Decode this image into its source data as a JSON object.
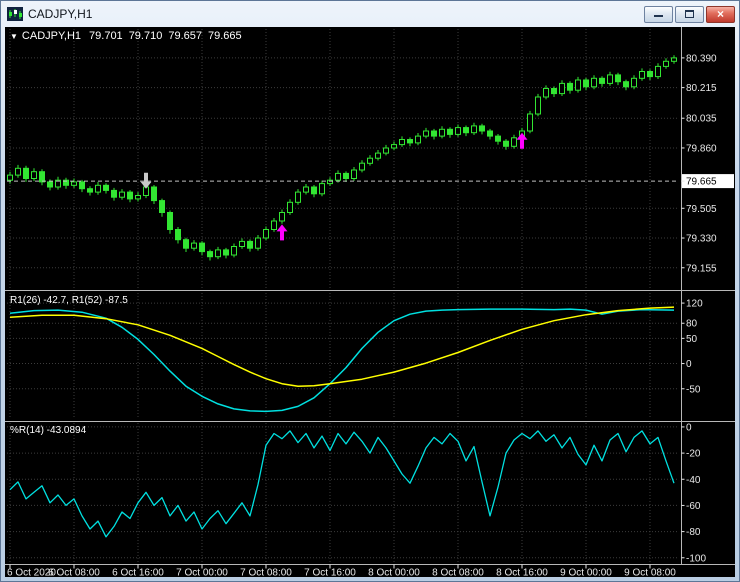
{
  "window": {
    "title": "CADJPY,H1",
    "close_glyph": "×"
  },
  "info_bar": {
    "dropdown_icon": "▼",
    "symbol": "CADJPY,H1",
    "open": "79.701",
    "high": "79.710",
    "low": "79.657",
    "close": "79.665"
  },
  "colors": {
    "background": "#000000",
    "grid": "#3c3c3c",
    "axis_text": "#e8e8e8",
    "separator": "#b8b8b8",
    "bid_line": "#c0c0c0",
    "bid_box_bg": "#ffffff",
    "bid_box_text": "#000000"
  },
  "time_axis": {
    "ticks": [
      {
        "index": 0,
        "label": "6 Oct 2020"
      },
      {
        "index": 8,
        "label": "6 Oct 08:00"
      },
      {
        "index": 16,
        "label": "6 Oct 16:00"
      },
      {
        "index": 24,
        "label": "7 Oct 00:00"
      },
      {
        "index": 32,
        "label": "7 Oct 08:00"
      },
      {
        "index": 40,
        "label": "7 Oct 16:00"
      },
      {
        "index": 48,
        "label": "8 Oct 00:00"
      },
      {
        "index": 56,
        "label": "8 Oct 08:00"
      },
      {
        "index": 64,
        "label": "8 Oct 16:00"
      },
      {
        "index": 72,
        "label": "9 Oct 00:00"
      },
      {
        "index": 80,
        "label": "9 Oct 08:00"
      }
    ]
  },
  "chart_data": [
    {
      "type": "candlestick",
      "title": "CADJPY,H1",
      "timeframe": "H1",
      "ylim": [
        79.03,
        80.56
      ],
      "price_ticks": [
        "80.390",
        "80.215",
        "80.035",
        "79.860",
        "79.505",
        "79.330",
        "79.155"
      ],
      "bid": {
        "price": 79.665,
        "label": "79.665"
      },
      "colors": {
        "outline": "#32e632",
        "wick": "#32e632",
        "bull": "#000000",
        "bear": "#32e632"
      },
      "arrows": [
        {
          "index": 17,
          "price": 79.62,
          "direction": "down",
          "color": "#c8c8c8"
        },
        {
          "index": 34,
          "price": 79.41,
          "direction": "up",
          "color": "#ff00ff"
        },
        {
          "index": 64,
          "price": 79.95,
          "direction": "up",
          "color": "#ff00ff"
        }
      ],
      "candles": [
        [
          79.67,
          79.72,
          79.65,
          79.7
        ],
        [
          79.7,
          79.76,
          79.685,
          79.74
        ],
        [
          79.74,
          79.755,
          79.66,
          79.68
        ],
        [
          79.68,
          79.74,
          79.665,
          79.72
        ],
        [
          79.72,
          79.735,
          79.64,
          79.66
        ],
        [
          79.66,
          79.675,
          79.61,
          79.63
        ],
        [
          79.63,
          79.69,
          79.615,
          79.67
        ],
        [
          79.67,
          79.685,
          79.62,
          79.64
        ],
        [
          79.64,
          79.68,
          79.625,
          79.66
        ],
        [
          79.66,
          79.672,
          79.6,
          79.62
        ],
        [
          79.62,
          79.635,
          79.58,
          79.6
        ],
        [
          79.6,
          79.66,
          79.585,
          79.64
        ],
        [
          79.64,
          79.652,
          79.592,
          79.61
        ],
        [
          79.61,
          79.625,
          79.55,
          79.57
        ],
        [
          79.57,
          79.618,
          79.555,
          79.6
        ],
        [
          79.6,
          79.612,
          79.54,
          79.56
        ],
        [
          79.56,
          79.6,
          79.545,
          79.58
        ],
        [
          79.58,
          79.652,
          79.565,
          79.63
        ],
        [
          79.63,
          79.642,
          79.53,
          79.55
        ],
        [
          79.55,
          79.562,
          79.455,
          79.48
        ],
        [
          79.48,
          79.492,
          79.355,
          79.38
        ],
        [
          79.38,
          79.395,
          79.298,
          79.32
        ],
        [
          79.32,
          79.332,
          79.248,
          79.27
        ],
        [
          79.27,
          79.318,
          79.256,
          79.3
        ],
        [
          79.3,
          79.312,
          79.228,
          79.25
        ],
        [
          79.25,
          79.262,
          79.198,
          79.22
        ],
        [
          79.22,
          79.278,
          79.206,
          79.26
        ],
        [
          79.26,
          79.272,
          79.21,
          79.23
        ],
        [
          79.23,
          79.298,
          79.216,
          79.28
        ],
        [
          79.28,
          79.328,
          79.266,
          79.31
        ],
        [
          79.31,
          79.322,
          79.25,
          79.27
        ],
        [
          79.27,
          79.348,
          79.256,
          79.33
        ],
        [
          79.33,
          79.398,
          79.316,
          79.38
        ],
        [
          79.38,
          79.448,
          79.366,
          79.43
        ],
        [
          79.43,
          79.498,
          79.414,
          79.48
        ],
        [
          79.48,
          79.558,
          79.466,
          79.54
        ],
        [
          79.54,
          79.618,
          79.526,
          79.6
        ],
        [
          79.6,
          79.648,
          79.586,
          79.63
        ],
        [
          79.63,
          79.642,
          79.57,
          79.59
        ],
        [
          79.59,
          79.668,
          79.576,
          79.65
        ],
        [
          79.65,
          79.688,
          79.636,
          79.67
        ],
        [
          79.67,
          79.728,
          79.656,
          79.71
        ],
        [
          79.71,
          79.722,
          79.66,
          79.68
        ],
        [
          79.68,
          79.748,
          79.666,
          79.73
        ],
        [
          79.73,
          79.788,
          79.716,
          79.77
        ],
        [
          79.77,
          79.818,
          79.756,
          79.8
        ],
        [
          79.8,
          79.848,
          79.786,
          79.83
        ],
        [
          79.83,
          79.878,
          79.816,
          79.86
        ],
        [
          79.86,
          79.898,
          79.846,
          79.88
        ],
        [
          79.88,
          79.928,
          79.866,
          79.91
        ],
        [
          79.91,
          79.922,
          79.87,
          79.89
        ],
        [
          79.89,
          79.948,
          79.876,
          79.93
        ],
        [
          79.93,
          79.978,
          79.916,
          79.96
        ],
        [
          79.96,
          79.972,
          79.91,
          79.93
        ],
        [
          79.93,
          79.988,
          79.916,
          79.97
        ],
        [
          79.97,
          79.982,
          79.92,
          79.94
        ],
        [
          79.94,
          79.998,
          79.926,
          79.98
        ],
        [
          79.98,
          79.992,
          79.93,
          79.95
        ],
        [
          79.95,
          80.008,
          79.936,
          79.99
        ],
        [
          79.99,
          80.002,
          79.94,
          79.96
        ],
        [
          79.96,
          79.972,
          79.91,
          79.93
        ],
        [
          79.93,
          79.942,
          79.88,
          79.9
        ],
        [
          79.9,
          79.912,
          79.85,
          79.87
        ],
        [
          79.87,
          79.938,
          79.856,
          79.92
        ],
        [
          79.92,
          79.978,
          79.904,
          79.96
        ],
        [
          79.96,
          80.078,
          79.946,
          80.06
        ],
        [
          80.06,
          80.178,
          80.046,
          80.16
        ],
        [
          80.16,
          80.228,
          80.146,
          80.21
        ],
        [
          80.21,
          80.222,
          80.16,
          80.18
        ],
        [
          80.18,
          80.258,
          80.166,
          80.24
        ],
        [
          80.24,
          80.252,
          80.18,
          80.2
        ],
        [
          80.2,
          80.278,
          80.186,
          80.26
        ],
        [
          80.26,
          80.272,
          80.2,
          80.22
        ],
        [
          80.22,
          80.288,
          80.206,
          80.27
        ],
        [
          80.27,
          80.282,
          80.22,
          80.24
        ],
        [
          80.24,
          80.308,
          80.226,
          80.29
        ],
        [
          80.29,
          80.302,
          80.23,
          80.25
        ],
        [
          80.25,
          80.262,
          80.2,
          80.22
        ],
        [
          80.22,
          80.288,
          80.206,
          80.27
        ],
        [
          80.27,
          80.328,
          80.256,
          80.31
        ],
        [
          80.31,
          80.322,
          80.26,
          80.28
        ],
        [
          80.28,
          80.358,
          80.266,
          80.34
        ],
        [
          80.34,
          80.388,
          80.326,
          80.37
        ],
        [
          80.37,
          80.405,
          80.356,
          80.39
        ]
      ]
    },
    {
      "type": "line",
      "label": "R1(26) -42.7, R1(52) -87.5",
      "ylim": [
        -110,
        140
      ],
      "yticks": [
        120,
        80,
        50,
        0,
        -50
      ],
      "series": [
        {
          "name": "R1(26)",
          "color": "#00e0e0",
          "points": [
            [
              0,
              100
            ],
            [
              3,
              105
            ],
            [
              6,
              106
            ],
            [
              9,
              102
            ],
            [
              12,
              90
            ],
            [
              14,
              72
            ],
            [
              16,
              48
            ],
            [
              18,
              18
            ],
            [
              20,
              -15
            ],
            [
              22,
              -45
            ],
            [
              24,
              -65
            ],
            [
              26,
              -80
            ],
            [
              28,
              -90
            ],
            [
              30,
              -94
            ],
            [
              32,
              -95
            ],
            [
              34,
              -93
            ],
            [
              36,
              -85
            ],
            [
              38,
              -68
            ],
            [
              40,
              -40
            ],
            [
              42,
              -8
            ],
            [
              44,
              30
            ],
            [
              46,
              62
            ],
            [
              48,
              85
            ],
            [
              50,
              98
            ],
            [
              52,
              104
            ],
            [
              54,
              106
            ],
            [
              56,
              107
            ],
            [
              60,
              108
            ],
            [
              64,
              108
            ],
            [
              68,
              107
            ],
            [
              70,
              108
            ],
            [
              72,
              106
            ],
            [
              74,
              98
            ],
            [
              76,
              104
            ],
            [
              79,
              107
            ],
            [
              83,
              106
            ]
          ]
        },
        {
          "name": "R1(52)",
          "color": "#ffff00",
          "points": [
            [
              0,
              92
            ],
            [
              4,
              96
            ],
            [
              8,
              96
            ],
            [
              12,
              89
            ],
            [
              16,
              77
            ],
            [
              20,
              56
            ],
            [
              24,
              30
            ],
            [
              26,
              14
            ],
            [
              28,
              -2
            ],
            [
              30,
              -17
            ],
            [
              32,
              -30
            ],
            [
              34,
              -40
            ],
            [
              36,
              -45
            ],
            [
              38,
              -44
            ],
            [
              40,
              -40
            ],
            [
              44,
              -31
            ],
            [
              48,
              -17
            ],
            [
              52,
              1
            ],
            [
              56,
              22
            ],
            [
              60,
              46
            ],
            [
              64,
              68
            ],
            [
              68,
              85
            ],
            [
              72,
              97
            ],
            [
              76,
              105
            ],
            [
              80,
              110
            ],
            [
              83,
              112
            ]
          ]
        }
      ]
    },
    {
      "type": "line",
      "label": "%R(14) -43.0894",
      "ylim": [
        -104,
        3
      ],
      "yticks": [
        0,
        -20,
        -40,
        -60,
        -80,
        -100
      ],
      "series": [
        {
          "name": "%R(14)",
          "color": "#00e0e0",
          "points": [
            [
              0,
              -48
            ],
            [
              1,
              -42
            ],
            [
              2,
              -55
            ],
            [
              3,
              -50
            ],
            [
              4,
              -45
            ],
            [
              5,
              -58
            ],
            [
              6,
              -52
            ],
            [
              7,
              -60
            ],
            [
              8,
              -55
            ],
            [
              9,
              -68
            ],
            [
              10,
              -78
            ],
            [
              11,
              -72
            ],
            [
              12,
              -84
            ],
            [
              13,
              -76
            ],
            [
              14,
              -65
            ],
            [
              15,
              -70
            ],
            [
              16,
              -58
            ],
            [
              17,
              -50
            ],
            [
              18,
              -60
            ],
            [
              19,
              -54
            ],
            [
              20,
              -68
            ],
            [
              21,
              -60
            ],
            [
              22,
              -72
            ],
            [
              23,
              -65
            ],
            [
              24,
              -78
            ],
            [
              25,
              -70
            ],
            [
              26,
              -64
            ],
            [
              27,
              -74
            ],
            [
              28,
              -66
            ],
            [
              29,
              -58
            ],
            [
              30,
              -68
            ],
            [
              31,
              -44
            ],
            [
              32,
              -14
            ],
            [
              33,
              -5
            ],
            [
              34,
              -9
            ],
            [
              35,
              -3
            ],
            [
              36,
              -12
            ],
            [
              37,
              -5
            ],
            [
              38,
              -16
            ],
            [
              39,
              -7
            ],
            [
              40,
              -18
            ],
            [
              41,
              -5
            ],
            [
              42,
              -13
            ],
            [
              43,
              -4
            ],
            [
              44,
              -11
            ],
            [
              45,
              -20
            ],
            [
              46,
              -8
            ],
            [
              47,
              -16
            ],
            [
              48,
              -26
            ],
            [
              49,
              -36
            ],
            [
              50,
              -43
            ],
            [
              51,
              -30
            ],
            [
              52,
              -16
            ],
            [
              53,
              -8
            ],
            [
              54,
              -13
            ],
            [
              55,
              -5
            ],
            [
              56,
              -11
            ],
            [
              57,
              -26
            ],
            [
              58,
              -15
            ],
            [
              59,
              -42
            ],
            [
              60,
              -68
            ],
            [
              61,
              -46
            ],
            [
              62,
              -20
            ],
            [
              63,
              -10
            ],
            [
              64,
              -5
            ],
            [
              65,
              -9
            ],
            [
              66,
              -3
            ],
            [
              67,
              -11
            ],
            [
              68,
              -6
            ],
            [
              69,
              -16
            ],
            [
              70,
              -8
            ],
            [
              71,
              -21
            ],
            [
              72,
              -29
            ],
            [
              73,
              -14
            ],
            [
              74,
              -26
            ],
            [
              75,
              -10
            ],
            [
              76,
              -5
            ],
            [
              77,
              -19
            ],
            [
              78,
              -8
            ],
            [
              79,
              -3
            ],
            [
              80,
              -13
            ],
            [
              81,
              -8
            ],
            [
              82,
              -26
            ],
            [
              83,
              -43
            ]
          ]
        }
      ]
    }
  ]
}
